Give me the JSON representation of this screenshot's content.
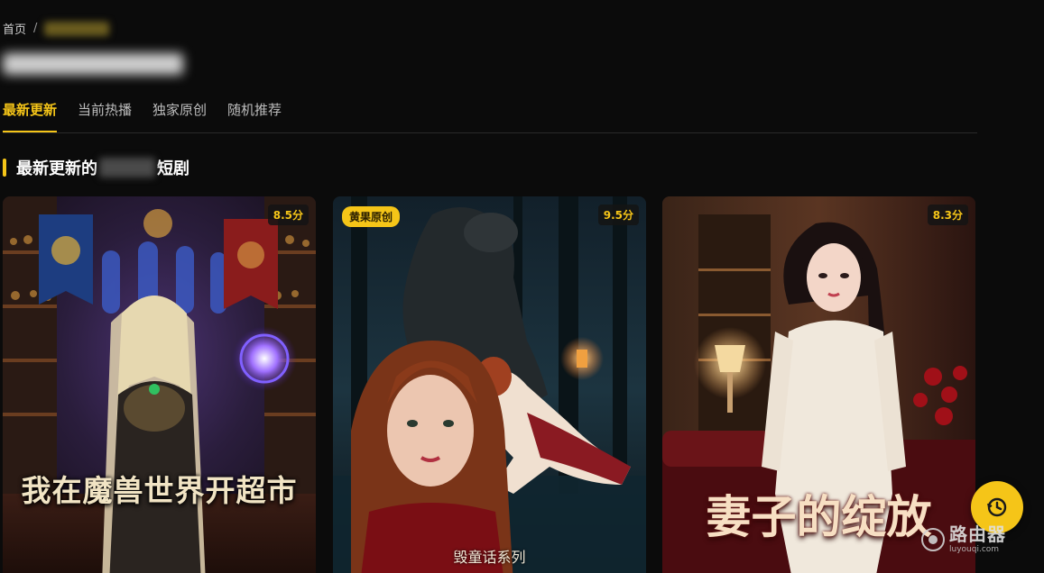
{
  "breadcrumb": {
    "home": "首页",
    "separator": "/"
  },
  "tabs": [
    {
      "label": "最新更新",
      "active": true
    },
    {
      "label": "当前热播",
      "active": false
    },
    {
      "label": "独家原创",
      "active": false
    },
    {
      "label": "随机推荐",
      "active": false
    }
  ],
  "section": {
    "title_prefix": "最新更新的",
    "title_suffix": "短剧"
  },
  "cards": [
    {
      "score": "8.5分",
      "title": "我在魔兽世界开超市"
    },
    {
      "score": "9.5分",
      "badge": "黄果原创",
      "series": "毁童话系列"
    },
    {
      "score": "8.3分",
      "title": "妻子的绽放"
    }
  ],
  "watermark": {
    "name": "路由器",
    "url": "luyouqi.com"
  },
  "icons": {
    "fab": "history-icon"
  },
  "colors": {
    "accent": "#f5c518",
    "background": "#0b0b0b"
  }
}
